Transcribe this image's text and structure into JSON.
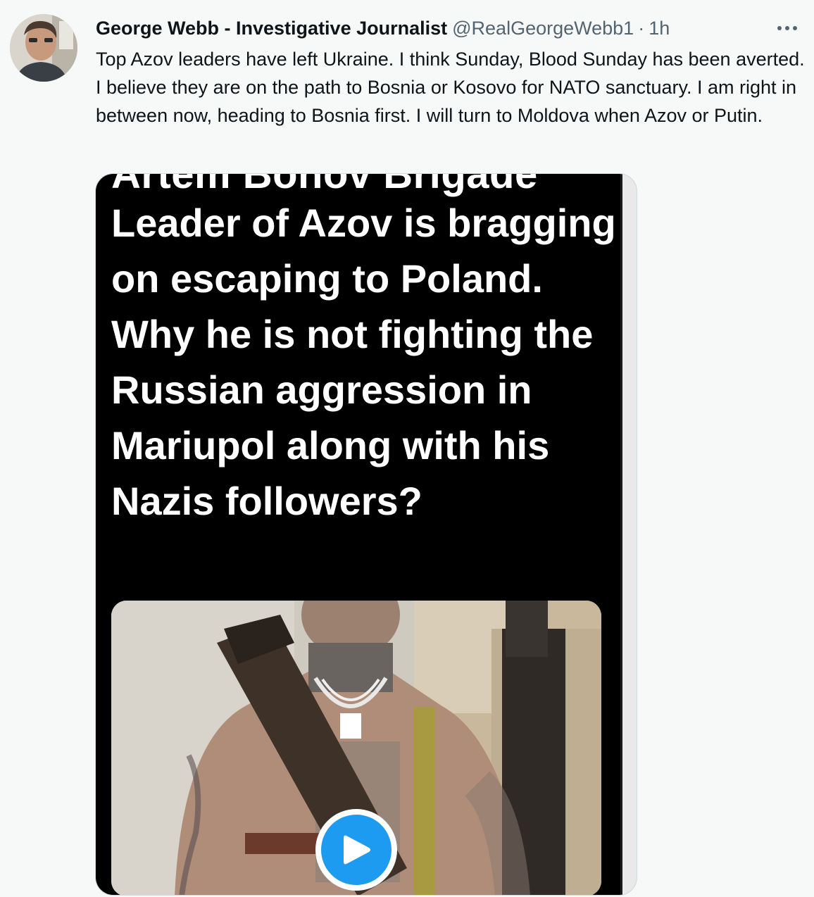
{
  "tweet": {
    "author_name": "George Webb - Investigative Journalist",
    "author_handle": "@RealGeorgeWebb1",
    "separator": "·",
    "timestamp": "1h",
    "text": "Top Azov leaders have left Ukraine.  I think Sunday, Blood Sunday has been averted. I believe they are on the path to Bosnia or Kosovo for NATO sanctuary. I am right in between now, heading to Bosnia first. I will turn to Moldova when Azov or Putin.",
    "more_icon": "ellipsis-icon"
  },
  "media": {
    "cut_off_heading": "Artem Bonov Brigade",
    "overlay_text": "Leader of Azov is bragging on escaping to Poland. Why he is not fighting the Russian aggression in Mariupol along with his Nazis followers?",
    "play_icon": "play-icon",
    "colors": {
      "play_blue": "#1d9bf0",
      "overlay_bg": "#000000",
      "overlay_text": "#ffffff"
    }
  }
}
